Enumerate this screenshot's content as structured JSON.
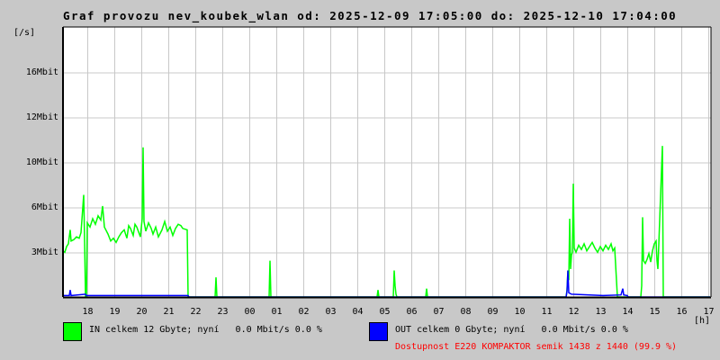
{
  "title": "Graf provozu nev_koubek_wlan od: 2025-12-09 17:05:00 do: 2025-12-10 17:04:00",
  "chart_data": {
    "type": "line",
    "title": "Graf provozu nev_koubek_wlan od: 2025-12-09 17:05:00 do: 2025-12-10 17:04:00",
    "ylabel": "[/s]",
    "xlabel": "[h]",
    "x_unit": "minutes since 2025-12-09 17:05",
    "xlim": [
      0,
      1440
    ],
    "ylim_mbit": [
      0,
      19.3
    ],
    "grid": true,
    "y_ticks": [
      {
        "label": "16Mbit",
        "value": 16
      },
      {
        "label": "12Mbit",
        "value": 12.8
      },
      {
        "label": "10Mbit",
        "value": 9.6
      },
      {
        "label": "6Mbit",
        "value": 6.4
      },
      {
        "label": "3Mbit",
        "value": 3.2
      }
    ],
    "x_ticks": [
      "18",
      "19",
      "20",
      "21",
      "22",
      "23",
      "00",
      "01",
      "02",
      "03",
      "04",
      "05",
      "06",
      "07",
      "08",
      "09",
      "10",
      "11",
      "12",
      "13",
      "14",
      "15",
      "16",
      "17"
    ],
    "series": [
      {
        "name": "IN",
        "color": "#00ff00",
        "points": [
          [
            0,
            3.3
          ],
          [
            4,
            3.2
          ],
          [
            8,
            3.6
          ],
          [
            12,
            3.8
          ],
          [
            16,
            4.8
          ],
          [
            18,
            4.0
          ],
          [
            24,
            4.1
          ],
          [
            30,
            4.3
          ],
          [
            36,
            4.2
          ],
          [
            40,
            4.6
          ],
          [
            46,
            7.3
          ],
          [
            48,
            4.0
          ],
          [
            50,
            0
          ],
          [
            52,
            0
          ],
          [
            54,
            5.3
          ],
          [
            60,
            5.0
          ],
          [
            66,
            5.6
          ],
          [
            72,
            5.2
          ],
          [
            78,
            5.8
          ],
          [
            84,
            5.5
          ],
          [
            88,
            6.5
          ],
          [
            92,
            5.0
          ],
          [
            100,
            4.5
          ],
          [
            106,
            4.0
          ],
          [
            112,
            4.2
          ],
          [
            118,
            3.9
          ],
          [
            124,
            4.3
          ],
          [
            130,
            4.6
          ],
          [
            136,
            4.8
          ],
          [
            142,
            4.2
          ],
          [
            146,
            5.1
          ],
          [
            150,
            4.9
          ],
          [
            156,
            4.4
          ],
          [
            160,
            5.2
          ],
          [
            164,
            5.0
          ],
          [
            172,
            4.3
          ],
          [
            176,
            5.6
          ],
          [
            178,
            10.7
          ],
          [
            180,
            5.4
          ],
          [
            184,
            4.7
          ],
          [
            190,
            5.3
          ],
          [
            196,
            4.9
          ],
          [
            200,
            4.5
          ],
          [
            206,
            5.0
          ],
          [
            212,
            4.3
          ],
          [
            220,
            4.8
          ],
          [
            226,
            5.4
          ],
          [
            232,
            4.7
          ],
          [
            238,
            5.0
          ],
          [
            244,
            4.4
          ],
          [
            250,
            4.9
          ],
          [
            256,
            5.2
          ],
          [
            262,
            5.1
          ],
          [
            266,
            4.9
          ],
          [
            276,
            4.8
          ],
          [
            278,
            0
          ],
          [
            338,
            0
          ],
          [
            340,
            1.4
          ],
          [
            342,
            0
          ],
          [
            458,
            0
          ],
          [
            460,
            2.6
          ],
          [
            462,
            0
          ],
          [
            698,
            0
          ],
          [
            700,
            0.5
          ],
          [
            702,
            0
          ],
          [
            734,
            0
          ],
          [
            736,
            1.9
          ],
          [
            738,
            0.8
          ],
          [
            740,
            0.2
          ],
          [
            742,
            0
          ],
          [
            806,
            0
          ],
          [
            808,
            0.6
          ],
          [
            810,
            0
          ],
          [
            1118,
            0
          ],
          [
            1120,
            0.5
          ],
          [
            1122,
            1.9
          ],
          [
            1124,
            1.2
          ],
          [
            1126,
            5.6
          ],
          [
            1128,
            2.0
          ],
          [
            1130,
            3.0
          ],
          [
            1132,
            3.2
          ],
          [
            1134,
            8.1
          ],
          [
            1136,
            3.5
          ],
          [
            1140,
            3.2
          ],
          [
            1146,
            3.7
          ],
          [
            1152,
            3.4
          ],
          [
            1158,
            3.8
          ],
          [
            1164,
            3.3
          ],
          [
            1170,
            3.6
          ],
          [
            1176,
            3.9
          ],
          [
            1182,
            3.5
          ],
          [
            1188,
            3.2
          ],
          [
            1194,
            3.6
          ],
          [
            1200,
            3.3
          ],
          [
            1206,
            3.7
          ],
          [
            1212,
            3.4
          ],
          [
            1218,
            3.8
          ],
          [
            1222,
            3.3
          ],
          [
            1226,
            3.5
          ],
          [
            1232,
            0
          ],
          [
            1284,
            0
          ],
          [
            1286,
            0.8
          ],
          [
            1288,
            5.7
          ],
          [
            1290,
            2.6
          ],
          [
            1294,
            2.4
          ],
          [
            1298,
            2.7
          ],
          [
            1302,
            3.1
          ],
          [
            1306,
            2.5
          ],
          [
            1310,
            3.3
          ],
          [
            1314,
            3.8
          ],
          [
            1318,
            4.0
          ],
          [
            1320,
            2.6
          ],
          [
            1322,
            2.0
          ],
          [
            1332,
            10.8
          ],
          [
            1334,
            0
          ],
          [
            1438,
            0
          ]
        ]
      },
      {
        "name": "OUT",
        "color": "#0000ff",
        "points": [
          [
            0,
            0.1
          ],
          [
            14,
            0.1
          ],
          [
            16,
            0.5
          ],
          [
            18,
            0.1
          ],
          [
            50,
            0.2
          ],
          [
            52,
            0.1
          ],
          [
            278,
            0.1
          ],
          [
            280,
            0
          ],
          [
            1118,
            0
          ],
          [
            1120,
            0.4
          ],
          [
            1122,
            1.9
          ],
          [
            1124,
            0.3
          ],
          [
            1130,
            0.2
          ],
          [
            1200,
            0.1
          ],
          [
            1240,
            0.15
          ],
          [
            1244,
            0.6
          ],
          [
            1246,
            0.15
          ],
          [
            1254,
            0.1
          ],
          [
            1256,
            0
          ],
          [
            1438,
            0
          ]
        ]
      }
    ]
  },
  "legend": {
    "in_text": "IN celkem 12 Gbyte; nyní   0.0 Mbit/s 0.0 %",
    "out_text": "OUT celkem 0 Gbyte; nyní   0.0 Mbit/s 0.0 %",
    "in_color": "#00ff00",
    "out_color": "#0000ff",
    "availability": "Dostupnost E220 KOMPAKTOR semik 1438 z 1440 (99.9 %)",
    "availability_color": "#ff0000"
  }
}
